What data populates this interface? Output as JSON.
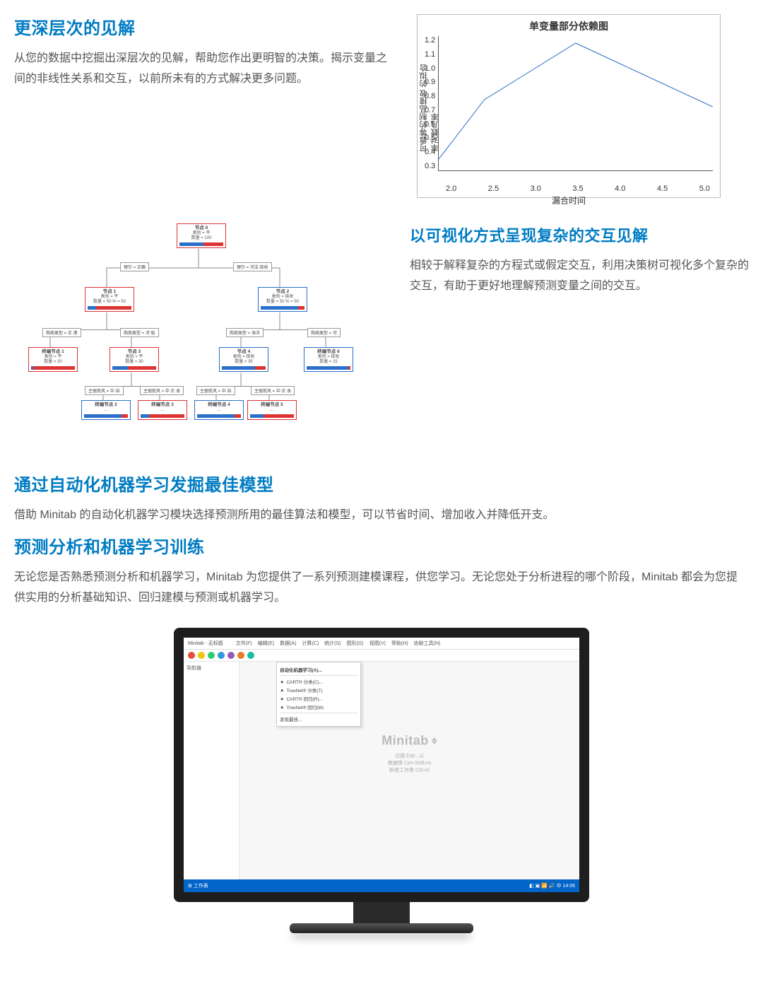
{
  "section1": {
    "title": "更深层次的见解",
    "body": "从您的数据中挖掘出深层次的见解，帮助您作出更明智的决策。揭示变量之间的非线性关系和交互，以前所未有的方式解决更多问题。"
  },
  "section2": {
    "title": "以可视化方式呈现复杂的交互见解",
    "body": "相较于解释复杂的方程式或假定交互，利用决策树可视化多个复杂的交互，有助于更好地理解预测变量之间的交互。"
  },
  "section3": {
    "title": "通过自动化机器学习发掘最佳模型",
    "body": "借助 Minitab 的自动化机器学习模块选择预测所用的最佳算法和模型，可以节省时间、增加收入并降低开支。"
  },
  "section4": {
    "title": "预测分析和机器学习训练",
    "body": "无论您是否熟悉预测分析和机器学习，Minitab 为您提供了一系列预测建模课程，供您学习。无论您处于分析进程的哪个阶段，Minitab 都会为您提供实用的分析基础知识、回归建模与预测或机器学习。"
  },
  "chart_data": {
    "type": "line",
    "title": "单变量部分依赖图",
    "xlabel": "漏合时间",
    "ylabel": "可靠等的制品接收 的拟合率对数几率",
    "x": [
      2.0,
      2.5,
      3.0,
      3.5,
      4.0,
      4.5,
      5.0
    ],
    "y": [
      0.38,
      0.8,
      1.0,
      1.2,
      1.05,
      0.9,
      0.75
    ],
    "xticks": [
      2.0,
      2.5,
      3.0,
      3.5,
      4.0,
      4.5,
      5.0
    ],
    "yticks": [
      0.3,
      0.4,
      0.5,
      0.6,
      0.7,
      0.8,
      0.9,
      1.0,
      1.1,
      1.2
    ],
    "ylim": [
      0.3,
      1.25
    ],
    "xlim": [
      2.0,
      5.0
    ]
  },
  "tree": {
    "nodes": {
      "root": {
        "title": "节点 0",
        "class": "类别 = 平",
        "count": "数量 = 100",
        "blue": 0.55,
        "red": 0.45,
        "border": "red"
      },
      "l1a": {
        "title": "节点 1",
        "class": "类别 = 平",
        "count": "数量 = 50  % = 50",
        "blue": 0.2,
        "red": 0.8,
        "border": "red"
      },
      "l1b": {
        "title": "节点 2",
        "class": "类别 = 接收",
        "count": "数量 = 50  % = 50",
        "blue": 0.85,
        "red": 0.15,
        "border": "blue"
      },
      "l2a": {
        "title": "终端节点 1",
        "class": "类别 = 平",
        "count": "数量 = 20",
        "blue": 0.05,
        "red": 0.95,
        "border": "red"
      },
      "l2b": {
        "title": "节点 3",
        "class": "类别 = 平",
        "count": "数量 = 30",
        "blue": 0.35,
        "red": 0.65,
        "border": "red"
      },
      "l2c": {
        "title": "节点 4",
        "class": "类别 = 接收",
        "count": "数量 = 35",
        "blue": 0.75,
        "red": 0.25,
        "border": "blue"
      },
      "l2d": {
        "title": "终端节点 6",
        "class": "类别 = 接收",
        "count": "数量 = 15",
        "blue": 0.95,
        "red": 0.05,
        "border": "blue"
      },
      "l3a": {
        "title": "终端节点 2",
        "class": "...",
        "count": "",
        "blue": 0.85,
        "red": 0.15,
        "border": "blue"
      },
      "l3b": {
        "title": "终端节点 3",
        "class": "...",
        "count": "",
        "blue": 0.2,
        "red": 0.8,
        "border": "red"
      },
      "l3c": {
        "title": "终端节点 4",
        "class": "...",
        "count": "",
        "blue": 0.85,
        "red": 0.15,
        "border": "blue"
      },
      "l3d": {
        "title": "终端节点 5",
        "class": "...",
        "count": "",
        "blue": 0.3,
        "red": 0.7,
        "border": "red"
      }
    },
    "splits": {
      "s0l": "理尔 = 正确",
      "s0r": "理尔 = 河洁 接收",
      "s1l": "购商类型 = 正 港",
      "s1r": "购商类型 = 河 船",
      "s2l": "购商类型 = 海洋",
      "s2r": "购商类型 = 河",
      "s3a": "主驱航风 = 中 自",
      "s3b": "主驱航风 = 中 正 本",
      "s3c": "主驱航风 = 中 自",
      "s3d": "主驱航风 = 中 正 本"
    }
  },
  "monitor": {
    "app_title": "Minitab - 无标题",
    "menu": [
      "文件(F)",
      "编辑(E)",
      "数据(A)",
      "计算(C)",
      "统计(S)",
      "图形(G)",
      "视图(V)",
      "帮助(H)",
      "协助工具(N)"
    ],
    "toolbar_colors": [
      "#e74c3c",
      "#f1c40f",
      "#2ecc71",
      "#3498db",
      "#9b59b6",
      "#e67e22",
      "#1abc9c"
    ],
    "side": "导航器",
    "dropdown": {
      "header": "自动化机器学习(A)...",
      "items": [
        "CART® 分类(C)...",
        "TreeNet® 分类(T)",
        "CART® 回归(R)...",
        "TreeNet® 回归(M)"
      ],
      "footer": "发现最佳..."
    },
    "logo": "Minitab",
    "center_lines": [
      "日期    Edit→G",
      "数据项   Ctrl+Shift+N",
      "新建工作表   Ctrl+N"
    ],
    "startbar_left": "⊞  工作表",
    "startbar_right": "◧ ▣ 📶 🔊 中  14:06"
  }
}
